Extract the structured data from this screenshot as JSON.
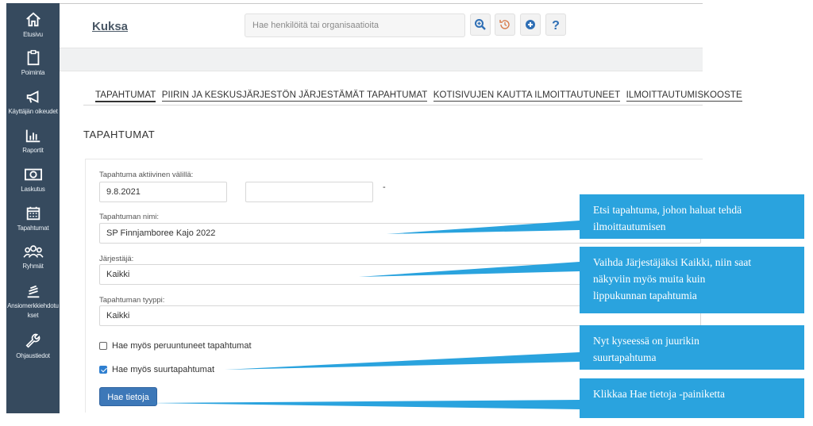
{
  "sidebar": {
    "items": [
      {
        "label": "Etusivu",
        "icon": "home-icon"
      },
      {
        "label": "Poiminta",
        "icon": "clipboard-icon"
      },
      {
        "label": "Käyttäjän oikeudet",
        "icon": "megaphone-icon"
      },
      {
        "label": "Raportit",
        "icon": "bar-chart-icon"
      },
      {
        "label": "Laskutus",
        "icon": "money-icon"
      },
      {
        "label": "Tapahtumat",
        "icon": "calendar-icon"
      },
      {
        "label": "Ryhmät",
        "icon": "group-icon"
      },
      {
        "label": "Ansiomerkkiehdotu",
        "label2": "kset",
        "icon": "stack-icon"
      },
      {
        "label": "Ohjaustiedot",
        "icon": "wrench-icon"
      }
    ]
  },
  "header": {
    "title": "Kuksa",
    "search_placeholder": "Hae henkilöitä tai organisaatioita",
    "buttons": [
      "search-zoom-icon",
      "history-icon",
      "plus-circle-icon",
      "help-icon"
    ]
  },
  "tabs": [
    {
      "label": "TAPAHTUMAT",
      "active": true
    },
    {
      "label": "PIIRIN JA KESKUSJÄRJESTÖN JÄRJESTÄMÄT TAPAHTUMAT",
      "active": false
    },
    {
      "label": "KOTISIVUJEN KAUTTA ILMOITTAUTUNEET",
      "active": false
    },
    {
      "label": "ILMOITTAUTUMISKOOSTE",
      "active": false
    }
  ],
  "section_title": "TAPAHTUMAT",
  "form": {
    "active_label": "Tapahtuma aktiivinen välillä:",
    "date_from": "9.8.2021",
    "date_to": "",
    "date_separator": "-",
    "name_label": "Tapahtuman nimi:",
    "name_value": "SP Finnjamboree Kajo 2022",
    "organizer_label": "Järjestäjä:",
    "organizer_value": "Kaikki",
    "type_label": "Tapahtuman tyyppi:",
    "type_value": "Kaikki",
    "cancelled_label": "Hae myös peruuntuneet tapahtumat",
    "cancelled_checked": false,
    "major_label": "Hae myös suurtapahtumat",
    "major_checked": true,
    "submit_label": "Hae tietoja"
  },
  "callouts": [
    {
      "lines": [
        "Etsi tapahtuma, johon haluat tehdä",
        "ilmoittautumisen"
      ]
    },
    {
      "lines": [
        "Vaihda Järjestäjäksi Kaikki, niin saat",
        "näkyviin myös muita kuin",
        "lippukunnan tapahtumia"
      ]
    },
    {
      "lines": [
        "Nyt kyseessä on juurikin",
        "suurtapahtuma"
      ]
    },
    {
      "lines": [
        "Klikkaa Hae tietoja -painiketta"
      ]
    }
  ],
  "colors": {
    "sidebar": "#364a5e",
    "callout": "#2aa3de",
    "primary_button": "#3d78b8"
  }
}
